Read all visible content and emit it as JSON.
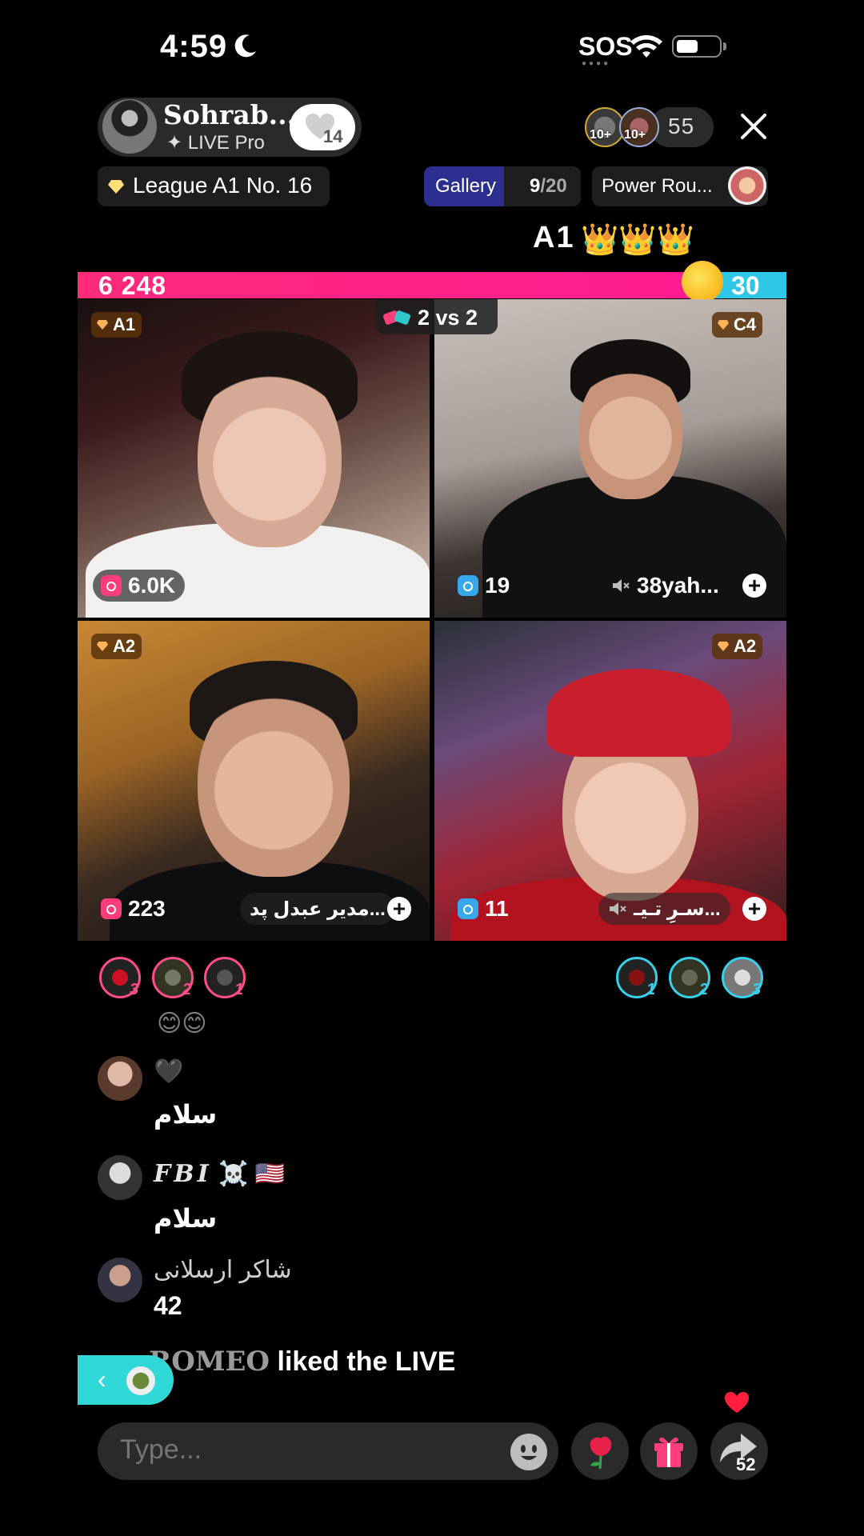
{
  "status_bar": {
    "time": "4:59",
    "sos": "SOS"
  },
  "host": {
    "name": "Sohrab...",
    "subtitle": "LIVE Pro",
    "likes": "14"
  },
  "viewers": {
    "badge_a": "10+",
    "badge_b": "10+",
    "count": "55"
  },
  "league": {
    "label": "League A1 No. 16"
  },
  "gallery": {
    "label": "Gallery",
    "current": "9",
    "total": "/20"
  },
  "power": {
    "label": "Power Rou..."
  },
  "rank": {
    "label": "A1",
    "crowns": "👑👑👑"
  },
  "battle": {
    "left_score": "6 248",
    "right_score": "30",
    "vs_label": "2 vs 2",
    "left_color": "#ff2a7a",
    "right_color": "#2ec7e8"
  },
  "tiles": [
    {
      "badge": "A1",
      "count": "6.0K",
      "name": ""
    },
    {
      "badge": "C4",
      "count": "19",
      "name": "38yah..."
    },
    {
      "badge": "A2",
      "count": "223",
      "name": "مدیر عبدل پد..."
    },
    {
      "badge": "A2",
      "count": "11",
      "name": "سـرِ تـیـ..."
    }
  ],
  "supporters": {
    "left": [
      {
        "rank": "3"
      },
      {
        "rank": "2"
      },
      {
        "rank": "1"
      }
    ],
    "right": [
      {
        "rank": "1"
      },
      {
        "rank": "2"
      },
      {
        "rank": "3"
      }
    ]
  },
  "chat": [
    {
      "name": "🖤",
      "message": "سلام"
    },
    {
      "name": "𝓕𝓑𝓘",
      "name_plain": "FBI",
      "suffix": "☠️ 🇺🇸",
      "message": "سلام"
    },
    {
      "name": "شاکر ارسلانی",
      "message": "42"
    }
  ],
  "chat_top_emoji": "😊😊",
  "liked": {
    "name": "ROMEO",
    "text": " liked the LIVE"
  },
  "input": {
    "placeholder": "Type..."
  },
  "share": {
    "count": "52"
  }
}
